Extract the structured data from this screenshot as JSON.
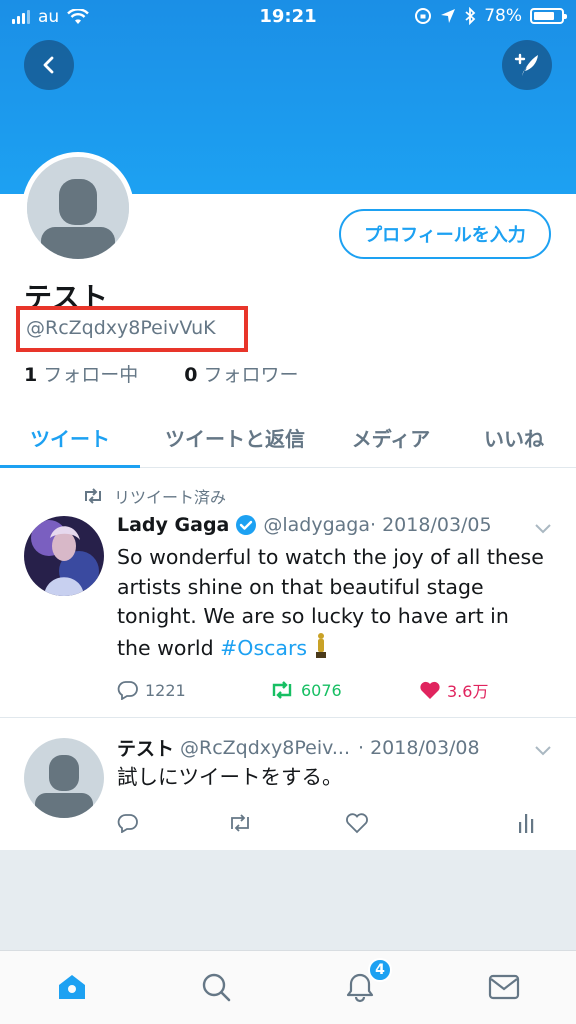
{
  "status_bar": {
    "carrier": "au",
    "time": "19:21",
    "battery": "78%",
    "battery_level": 0.78
  },
  "profile": {
    "name": "テスト",
    "handle": "@RcZqdxy8PeivVuK",
    "edit_button": "プロフィールを入力",
    "following_count": "1",
    "following_label": "フォロー中",
    "followers_count": "0",
    "followers_label": "フォロワー"
  },
  "tabs": [
    {
      "label": "ツイート",
      "active": true
    },
    {
      "label": "ツイートと返信",
      "active": false
    },
    {
      "label": "メディア",
      "active": false
    },
    {
      "label": "いいね",
      "active": false
    }
  ],
  "tweets": [
    {
      "retweet_note": "リツイート済み",
      "name": "Lady Gaga",
      "verified": true,
      "handle": "@ladygaga",
      "date": "· 2018/03/05",
      "text": "So wonderful to watch the joy of all these artists shine on that beautiful stage tonight. We are so lucky to have art in the world ",
      "hashtag": "#Oscars",
      "replies": "1221",
      "retweets": "6076",
      "likes": "3.6万"
    },
    {
      "name": "テスト",
      "handle": "@RcZqdxy8Peiv...",
      "date": "· 2018/03/08",
      "text": "試しにツイートをする。"
    }
  ],
  "tabbar": {
    "notifications_badge": "4"
  },
  "colors": {
    "accent": "#1da1f2",
    "retweet_green": "#17bf63",
    "like_red": "#e0245e",
    "highlight_box": "#e8352a"
  }
}
